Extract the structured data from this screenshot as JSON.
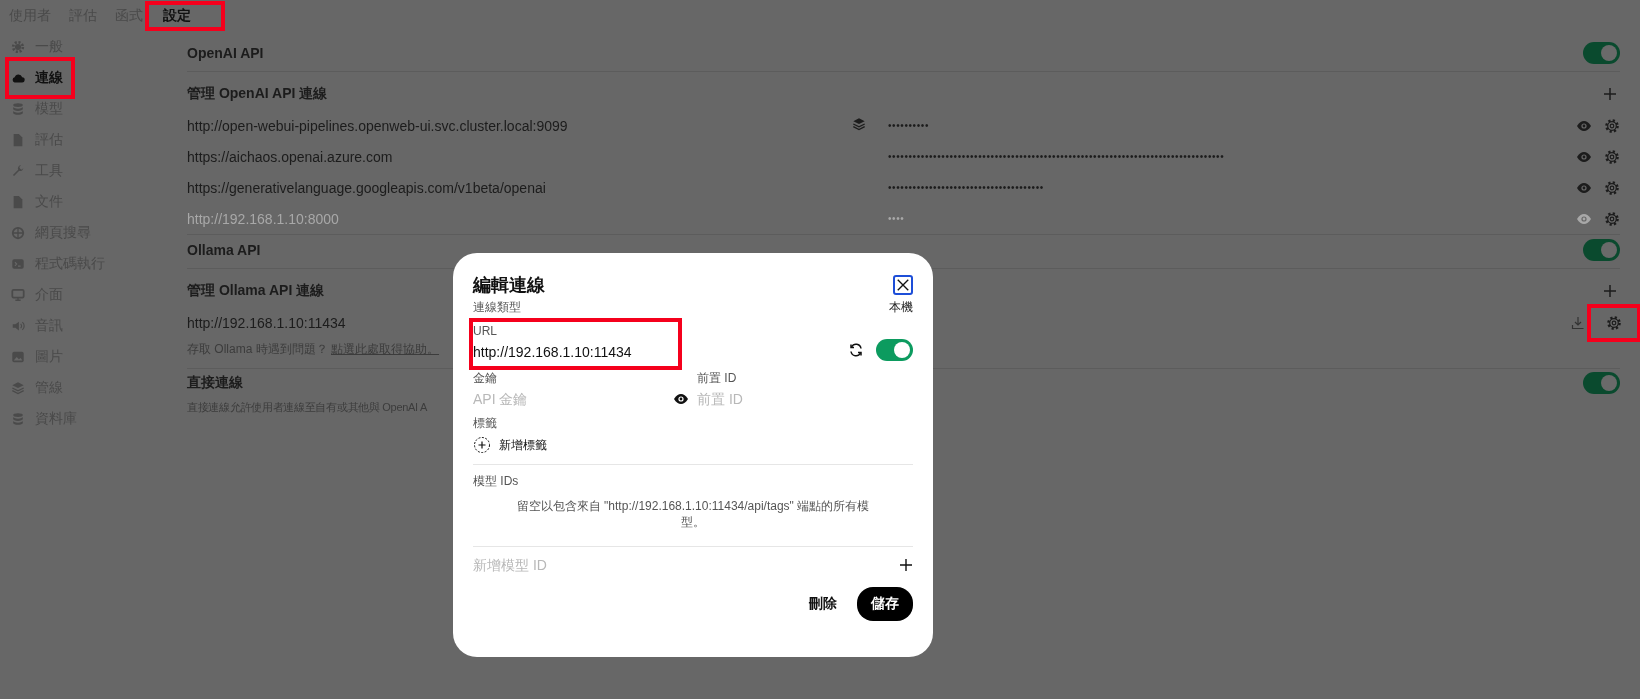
{
  "top_tabs": [
    {
      "label": "使用者",
      "selected": false,
      "highlighted": false
    },
    {
      "label": "評估",
      "selected": false,
      "highlighted": false
    },
    {
      "label": "函式",
      "selected": false,
      "highlighted": false
    },
    {
      "label": "設定",
      "selected": true,
      "highlighted": true
    }
  ],
  "sidebar": {
    "items": [
      {
        "label": "一般",
        "kind": "gear",
        "selected": false,
        "highlighted": false
      },
      {
        "label": "連線",
        "kind": "cloud",
        "selected": true,
        "highlighted": true
      },
      {
        "label": "模型",
        "kind": "database",
        "selected": false,
        "highlighted": false
      },
      {
        "label": "評估",
        "kind": "document",
        "selected": false,
        "highlighted": false
      },
      {
        "label": "工具",
        "kind": "wrench",
        "selected": false,
        "highlighted": false
      },
      {
        "label": "文件",
        "kind": "document",
        "selected": false,
        "highlighted": false
      },
      {
        "label": "網頁搜尋",
        "kind": "globe",
        "selected": false,
        "highlighted": false
      },
      {
        "label": "程式碼執行",
        "kind": "terminal",
        "selected": false,
        "highlighted": false
      },
      {
        "label": "介面",
        "kind": "monitor",
        "selected": false,
        "highlighted": false
      },
      {
        "label": "音訊",
        "kind": "speaker",
        "selected": false,
        "highlighted": false
      },
      {
        "label": "圖片",
        "kind": "image",
        "selected": false,
        "highlighted": false
      },
      {
        "label": "管線",
        "kind": "layers",
        "selected": false,
        "highlighted": false
      },
      {
        "label": "資料庫",
        "kind": "database",
        "selected": false,
        "highlighted": false
      }
    ]
  },
  "openai": {
    "title": "OpenAI API",
    "on": true,
    "manage_label": "管理 OpenAI API 連線",
    "connections": [
      {
        "url": "http://open-webui-pipelines.openweb-ui.svc.cluster.local:9099",
        "pipeline": true,
        "key_mask": "••••••••••",
        "disabled": false
      },
      {
        "url": "https://aichaos.openai.azure.com",
        "pipeline": false,
        "key_mask": "••••••••••••••••••••••••••••••••••••••••••••••••••••••••••••••••••••••••••••••••••",
        "disabled": false
      },
      {
        "url": "https://generativelanguage.googleapis.com/v1beta/openai",
        "pipeline": false,
        "key_mask": "••••••••••••••••••••••••••••••••••••••",
        "disabled": false
      },
      {
        "url": "http://192.168.1.10:8000",
        "pipeline": false,
        "key_mask": "••••",
        "disabled": true
      }
    ]
  },
  "ollama": {
    "title": "Ollama API",
    "on": true,
    "manage_label": "管理 Ollama API 連線",
    "connections": [
      {
        "url": "http://192.168.1.10:11434",
        "settings_highlighted": true
      }
    ],
    "help_text": "存取 Ollama 時遇到問題？",
    "help_link": "點選此處取得協助。"
  },
  "direct": {
    "title": "直接連線",
    "on": true,
    "description": "直接連線允許使用者連線至自有或其他與 OpenAI A"
  },
  "dialog": {
    "title": "編輯連線",
    "type_label": "連線類型",
    "type_value": "本機",
    "url_label": "URL",
    "url_value": "http://192.168.1.10:11434",
    "url_highlighted": true,
    "on": true,
    "key_label": "金鑰",
    "key_placeholder": "API 金鑰",
    "prefix_label": "前置 ID",
    "prefix_placeholder": "前置 ID",
    "tags_label": "標籤",
    "add_tag": "新增標籤",
    "models_label": "模型 IDs",
    "models_hint": "留空以包含來自 \"http://192.168.1.10:11434/api/tags\" 端點的所有模型。",
    "add_model_placeholder": "新增模型 ID",
    "delete_label": "刪除",
    "save_label": "儲存"
  }
}
